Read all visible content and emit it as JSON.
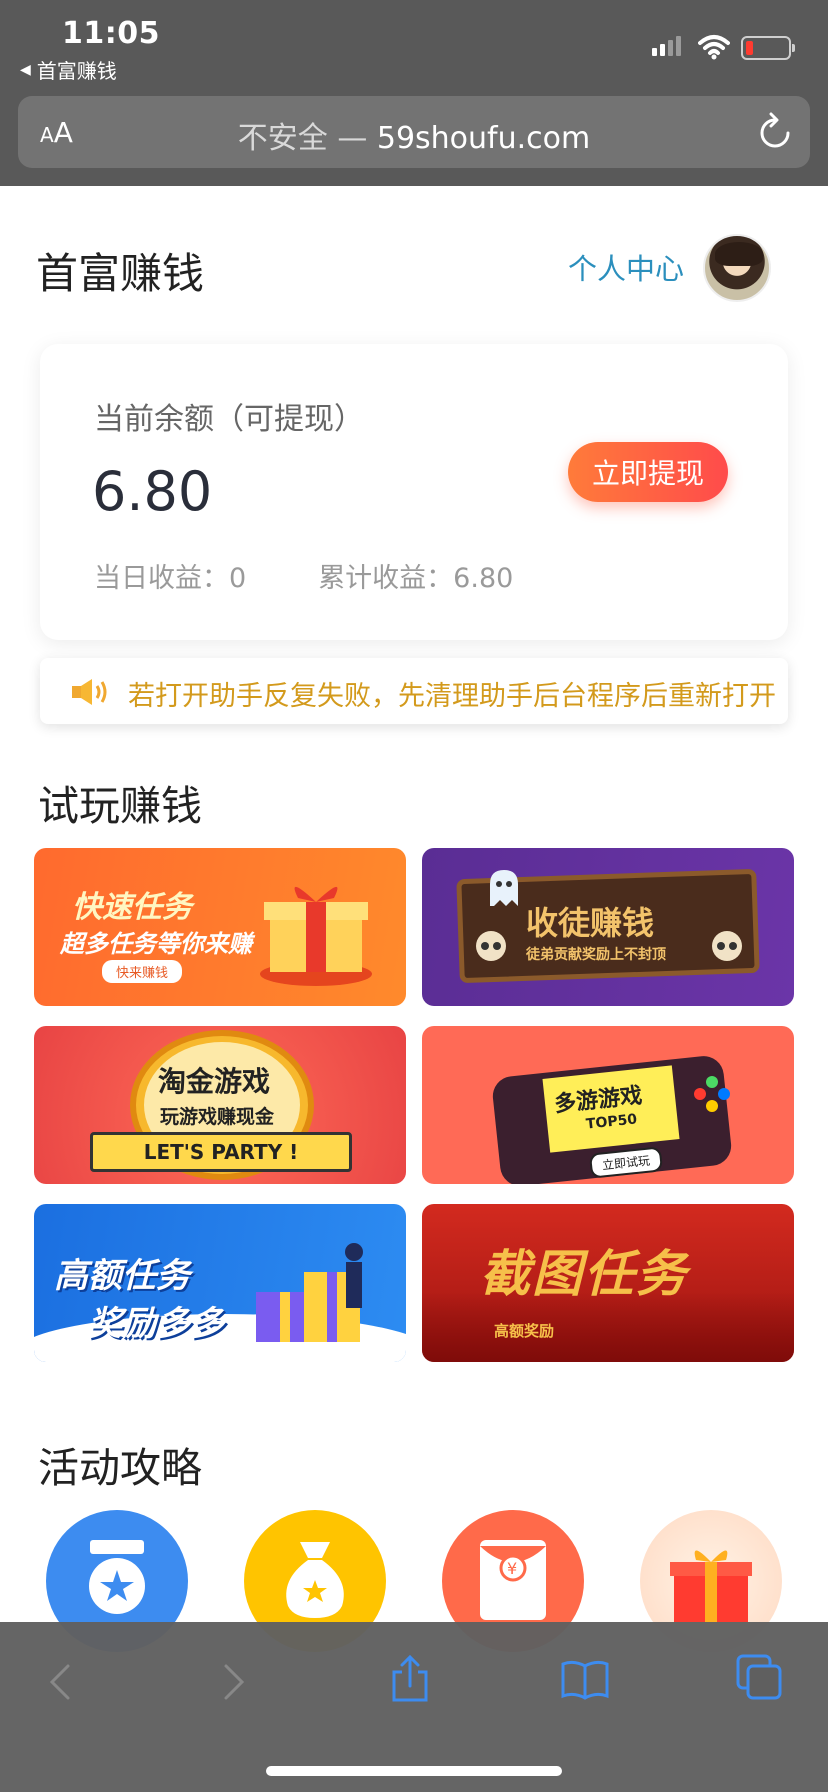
{
  "status": {
    "time": "11:05",
    "back_app": "首富赚钱"
  },
  "browser": {
    "aa": "AA",
    "security": "不安全",
    "separator": "—",
    "domain": "59shoufu.com"
  },
  "header": {
    "title": "首富赚钱",
    "personal_center": "个人中心"
  },
  "balance": {
    "label": "当前余额（可提现）",
    "value": "6.80",
    "withdraw": "立即提现",
    "today": "当日收益：0",
    "total": "累计收益：6.80"
  },
  "notice": "若打开助手反复失败，先清理助手后台程序后重新打开",
  "trial": {
    "title": "试玩赚钱",
    "banners": [
      {
        "title": "快速任务",
        "subtitle": "超多任务等你来赚",
        "tag": "快来赚钱"
      },
      {
        "title": "收徒赚钱",
        "subtitle": "徒弟贡献奖励上不封顶"
      },
      {
        "title": "淘金游戏",
        "subtitle": "玩游戏赚现金",
        "tag": "LET'S PARTY !"
      },
      {
        "title": "多游游戏",
        "subtitle": "TOP50",
        "tag": "立即试玩"
      },
      {
        "title": "高额任务",
        "subtitle": "奖励多多"
      },
      {
        "title": "截图任务",
        "subtitle": "高额奖励"
      }
    ]
  },
  "activity": {
    "title": "活动攻略"
  }
}
